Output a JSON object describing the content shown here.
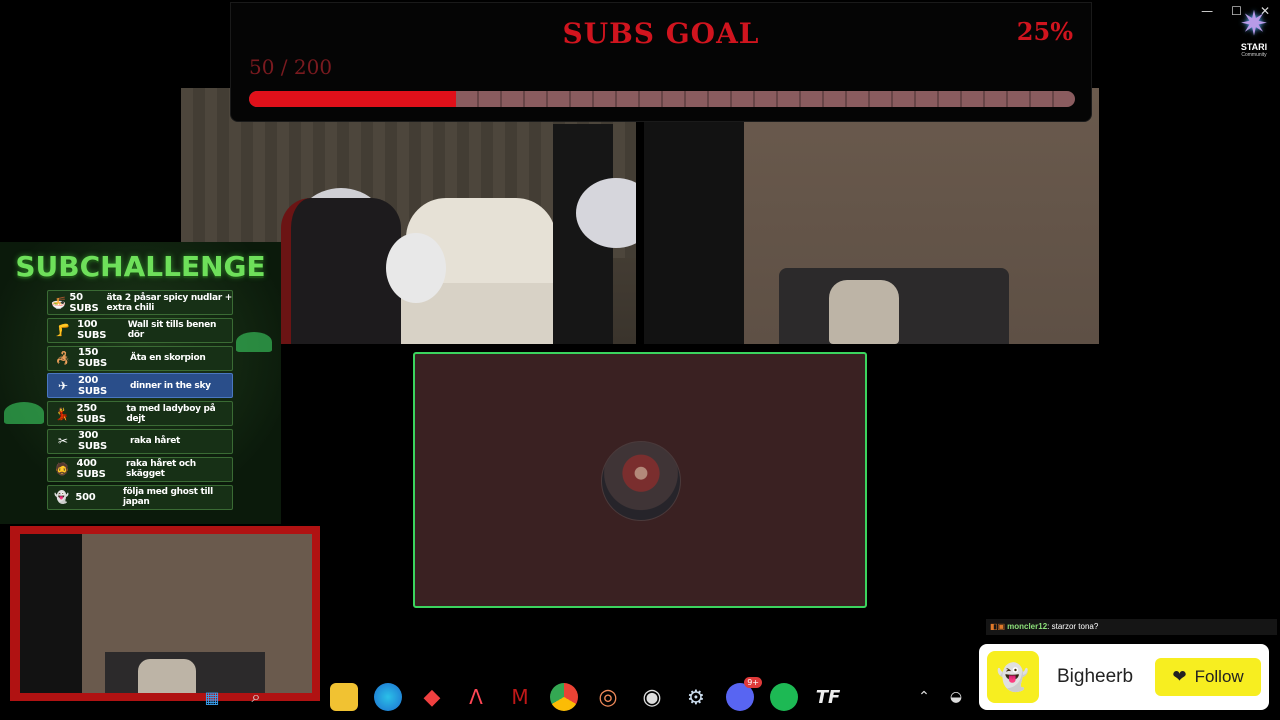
{
  "window": {
    "minimize": "—",
    "maximize": "☐",
    "close": "✕"
  },
  "goal": {
    "title": "SUBS GOAL",
    "percent_label": "25%",
    "count_label": "50 / 200",
    "progress": 0.25,
    "fill_color": "#e0101a"
  },
  "subchallenge": {
    "title": "SUBCHALLENGE",
    "items": [
      {
        "icon": "🍜",
        "subs": "50 SUBS",
        "desc": "äta 2 påsar spicy nudlar + extra chili"
      },
      {
        "icon": "🦵",
        "subs": "100 SUBS",
        "desc": "Wall sit tills benen dör"
      },
      {
        "icon": "🦂",
        "subs": "150 SUBS",
        "desc": "Äta en skorpion"
      },
      {
        "icon": "✈",
        "subs": "200 SUBS",
        "desc": "dinner in the sky"
      },
      {
        "icon": "💃",
        "subs": "250 SUBS",
        "desc": "ta med ladyboy på dejt"
      },
      {
        "icon": "✂",
        "subs": "300 SUBS",
        "desc": "raka håret"
      },
      {
        "icon": "🧔",
        "subs": "400 SUBS",
        "desc": "raka håret och skägget"
      },
      {
        "icon": "👻",
        "subs": "500",
        "desc": "följa med ghost till japan"
      }
    ]
  },
  "chat": {
    "badges": "◧▣",
    "user": "moncler12",
    "separator": ":",
    "message": "starzor tona?"
  },
  "snap": {
    "logo": "👻",
    "name": "Bigheerb",
    "follow_icon": "❤",
    "follow_label": "Follow"
  },
  "logo": {
    "star": "✷",
    "name": "STARI",
    "sub": "Community"
  },
  "taskbar": {
    "badge": "9+",
    "icons": [
      "windows-icon",
      "search-icon",
      "folder-icon",
      "edge-icon",
      "app-diamond-icon",
      "arch-icon",
      "mcafee-icon",
      "chrome-icon",
      "spiral-app-icon",
      "obs-icon",
      "steam-icon",
      "discord-icon",
      "spotify-icon",
      "tf-icon",
      "tray-chevron-icon",
      "tray-app-icon"
    ]
  }
}
